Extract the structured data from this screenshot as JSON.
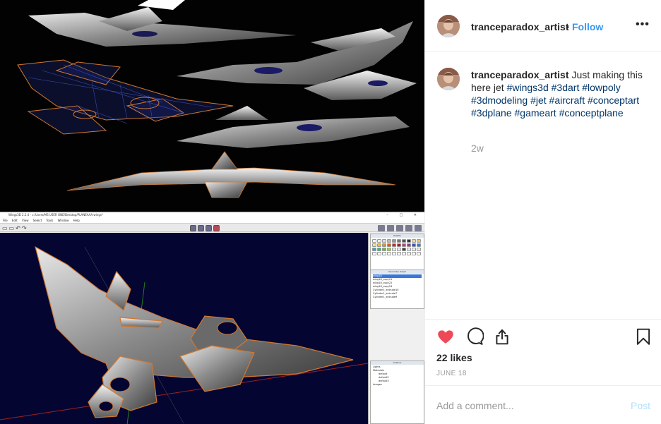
{
  "app": {
    "title": "Wings3D 2.2.4 - c:/Users/MS USER ONE/Desktop/PLANEAAA.wings*",
    "menu": [
      "File",
      "Edit",
      "View",
      "Select",
      "Tools",
      "Window",
      "Help"
    ],
    "panels": {
      "palette_title": "Palette",
      "geometry_title": "Geometry Graph",
      "outliner_title": "Outliner",
      "objects": [
        "wing18",
        "wing18_copy21",
        "wing18_copy22",
        "wing18_copy24",
        "Cylinder1_extrude10",
        "Cylinder1_extrude7",
        "Cylinder1_extrude9"
      ],
      "selected_object": "wing18",
      "outliner_items": [
        "Lights",
        "Materials",
        "default",
        "default2",
        "default3",
        "Images"
      ]
    }
  },
  "post": {
    "username": "tranceparadox_artist",
    "separator": "•",
    "follow_label": "Follow",
    "more_label": "•••",
    "caption_text": "Just making this here jet",
    "hashtags": [
      "#wings3d",
      "#3dart",
      "#lowpoly",
      "#3dmodeling",
      "#jet",
      "#aircraft",
      "#conceptart",
      "#3dplane",
      "#gameart",
      "#conceptplane"
    ],
    "time_ago": "2w",
    "likes": "22 likes",
    "date": "JUNE 18",
    "comment_placeholder": "Add a comment...",
    "post_label": "Post"
  },
  "colors": {
    "link": "#3897f0",
    "hashtag": "#003569",
    "like": "#ed4956",
    "muted": "#999999",
    "post_disabled": "#b2dffc"
  },
  "icons": {
    "like": "heart-filled-icon",
    "comment": "speech-bubble-icon",
    "share": "share-upload-icon",
    "save": "bookmark-icon",
    "more": "more-options-icon"
  }
}
